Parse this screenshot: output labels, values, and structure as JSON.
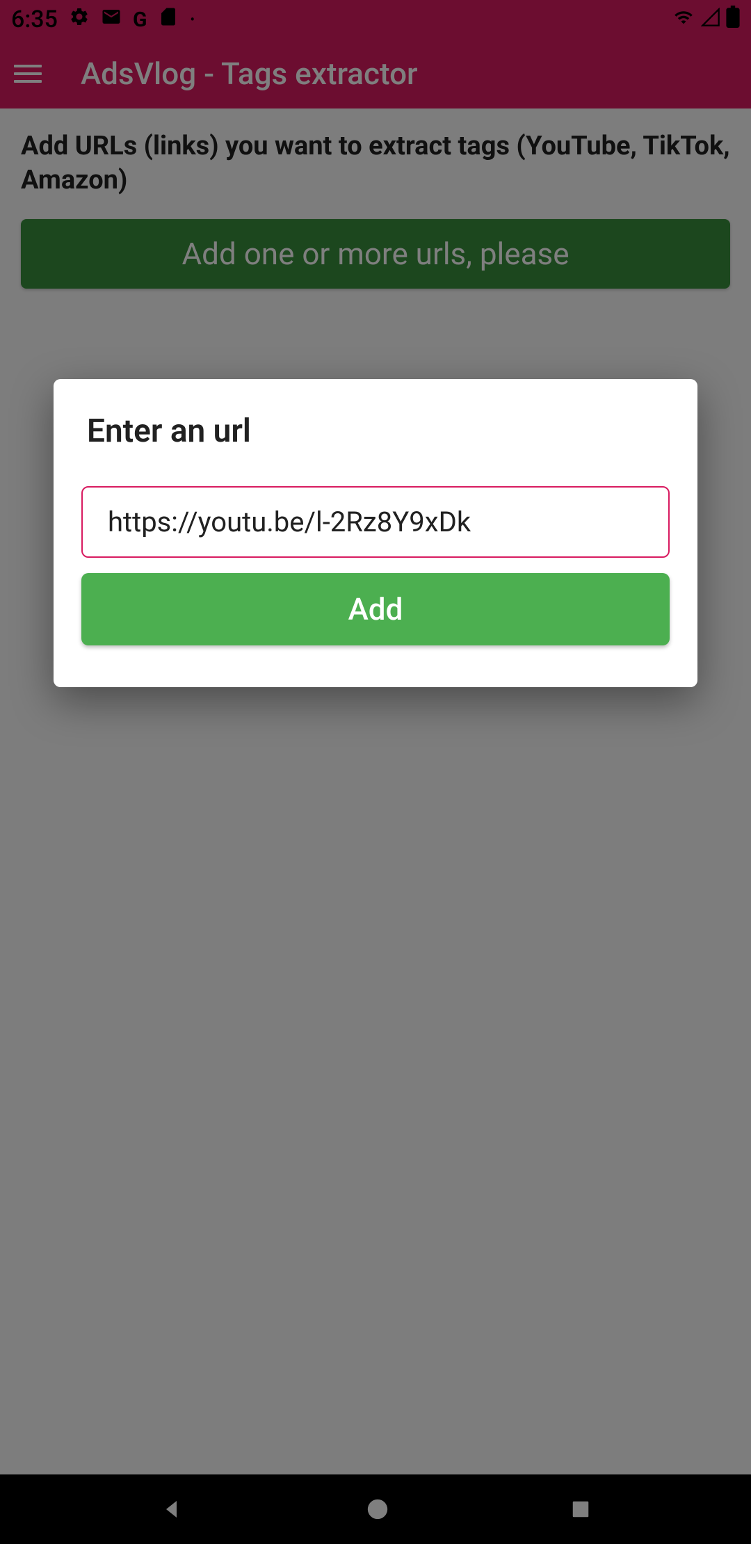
{
  "statusBar": {
    "time": "6:35"
  },
  "appBar": {
    "title": "AdsVlog - Tags extractor"
  },
  "main": {
    "instruction": "Add URLs (links) you want to extract tags (YouTube, TikTok, Amazon)",
    "addUrlsButtonLabel": "Add one or more urls, please"
  },
  "dialog": {
    "title": "Enter an url",
    "urlValue": "https://youtu.be/l-2Rz8Y9xDk",
    "addButtonLabel": "Add"
  }
}
